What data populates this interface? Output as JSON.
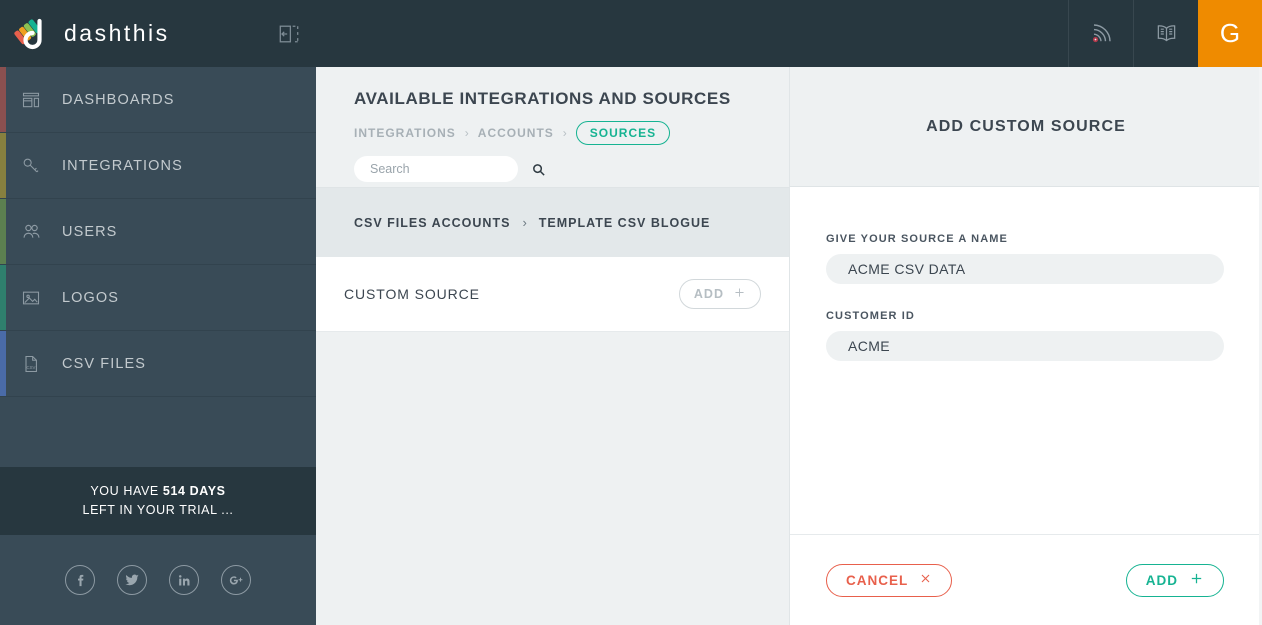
{
  "brand": {
    "name": "dashthis",
    "logo_icon": "dashthis-logo-icon",
    "collapse_icon": "collapse-panel-icon"
  },
  "sidebar": {
    "items": [
      {
        "label": "DASHBOARDS",
        "icon": "dashboard-icon",
        "accent": "#8a5050"
      },
      {
        "label": "INTEGRATIONS",
        "icon": "key-icon",
        "accent": "#87803f"
      },
      {
        "label": "USERS",
        "icon": "users-icon",
        "accent": "#5c8050"
      },
      {
        "label": "LOGOS",
        "icon": "image-icon",
        "accent": "#2f7f6d"
      },
      {
        "label": "CSV FILES",
        "icon": "csv-file-icon",
        "accent": "#4a6ba8"
      }
    ],
    "trial": {
      "line1_prefix": "YOU HAVE ",
      "line1_days": "514 DAYS",
      "line2": "LEFT IN YOUR TRIAL ..."
    },
    "social": [
      {
        "name": "facebook-icon",
        "glyph": "f"
      },
      {
        "name": "twitter-icon",
        "glyph": "t"
      },
      {
        "name": "linkedin-icon",
        "glyph": "in"
      },
      {
        "name": "googleplus-icon",
        "glyph": "g+"
      }
    ]
  },
  "topbar": {
    "feed_icon": "rss-feed-icon",
    "docs_icon": "book-icon",
    "avatar_initial": "G",
    "avatar_color": "#ef8b00"
  },
  "main": {
    "page_title": "AVAILABLE INTEGRATIONS AND SOURCES",
    "breadcrumbs": [
      {
        "label": "INTEGRATIONS",
        "active": false
      },
      {
        "label": "ACCOUNTS",
        "active": false
      },
      {
        "label": "SOURCES",
        "active": true
      }
    ],
    "separator": "›",
    "search": {
      "value": "",
      "placeholder": "Search",
      "icon": "search-icon"
    },
    "sub_breadcrumbs": [
      {
        "label": "CSV FILES ACCOUNTS"
      },
      {
        "label": "TEMPLATE CSV BLOGUE"
      }
    ],
    "source_row": {
      "name": "CUSTOM SOURCE",
      "add_label": "ADD",
      "add_icon": "plus-icon"
    }
  },
  "panel": {
    "title": "ADD CUSTOM SOURCE",
    "fields": [
      {
        "label": "GIVE YOUR SOURCE A NAME",
        "value": "ACME CSV DATA",
        "placeholder": ""
      },
      {
        "label": "CUSTOMER ID",
        "value": "ACME",
        "placeholder": ""
      }
    ],
    "cancel_label": "CANCEL",
    "cancel_icon": "close-x-icon",
    "cancel_color": "#e8604c",
    "add_label": "ADD",
    "add_icon": "plus-icon",
    "add_color": "#16b392"
  }
}
